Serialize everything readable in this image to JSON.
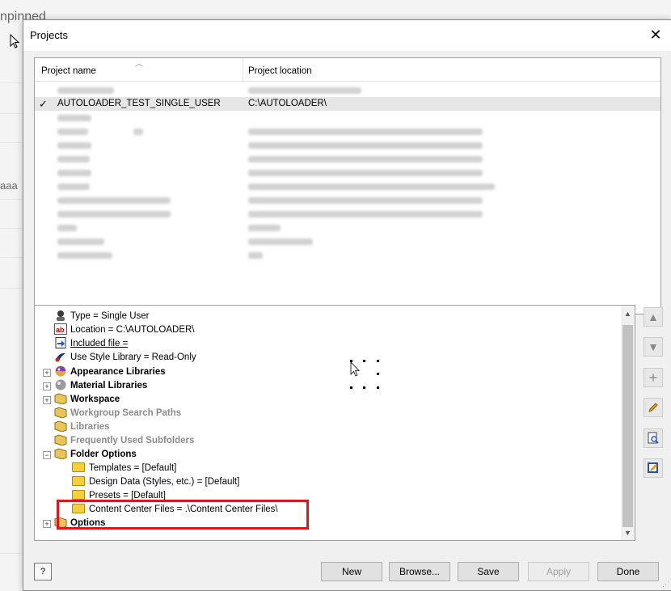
{
  "background": {
    "title_fragment": "npinned",
    "text_fragment": "aaa"
  },
  "dialog": {
    "title": "Projects",
    "close_glyph": "✕"
  },
  "project_list": {
    "columns": {
      "name": "Project name",
      "location": "Project location"
    },
    "selected_project": {
      "check": "✓",
      "name": "AUTOLOADER_TEST_SINGLE_USER",
      "location": "C:\\AUTOLOADER\\"
    }
  },
  "tree": {
    "items": [
      {
        "label": "Type = Single User",
        "icon": "user-type-icon"
      },
      {
        "label": "Location = C:\\AUTOLOADER\\",
        "icon": "ab-text-icon"
      },
      {
        "label": "Included file =",
        "icon": "included-file-icon"
      },
      {
        "label": "Use Style Library = Read-Only",
        "icon": "style-library-icon"
      },
      {
        "label": "Appearance Libraries",
        "icon": "appearance-icon"
      },
      {
        "label": "Material Libraries",
        "icon": "material-icon"
      },
      {
        "label": "Workspace",
        "icon": "workspace-icon"
      },
      {
        "label": "Workgroup Search Paths",
        "icon": "workgroup-icon"
      },
      {
        "label": "Libraries",
        "icon": "libraries-icon"
      },
      {
        "label": "Frequently Used Subfolders",
        "icon": "subfolders-icon"
      },
      {
        "label": "Folder Options",
        "icon": "folder-options-icon"
      },
      {
        "label": "Templates = [Default]",
        "icon": "folder-icon"
      },
      {
        "label": "Design Data (Styles, etc.) = [Default]",
        "icon": "folder-icon"
      },
      {
        "label": "Presets = [Default]",
        "icon": "folder-icon"
      },
      {
        "label": "Content Center Files = .\\Content Center Files\\",
        "icon": "folder-icon"
      },
      {
        "label": "Options",
        "icon": "options-icon"
      }
    ],
    "scroll_up": "▲",
    "scroll_down": "▼"
  },
  "side_buttons": {
    "up": "▲",
    "down": "▼",
    "add": "+",
    "edit_icon": "pencil-icon",
    "find_icon": "find-icon",
    "edit_file_icon": "edit-file-icon"
  },
  "buttons": {
    "help": "?",
    "new": "New",
    "browse": "Browse...",
    "save": "Save",
    "apply": "Apply",
    "done": "Done"
  },
  "colors": {
    "highlight_box": "#e0141e",
    "folder": "#f4cf3a"
  }
}
